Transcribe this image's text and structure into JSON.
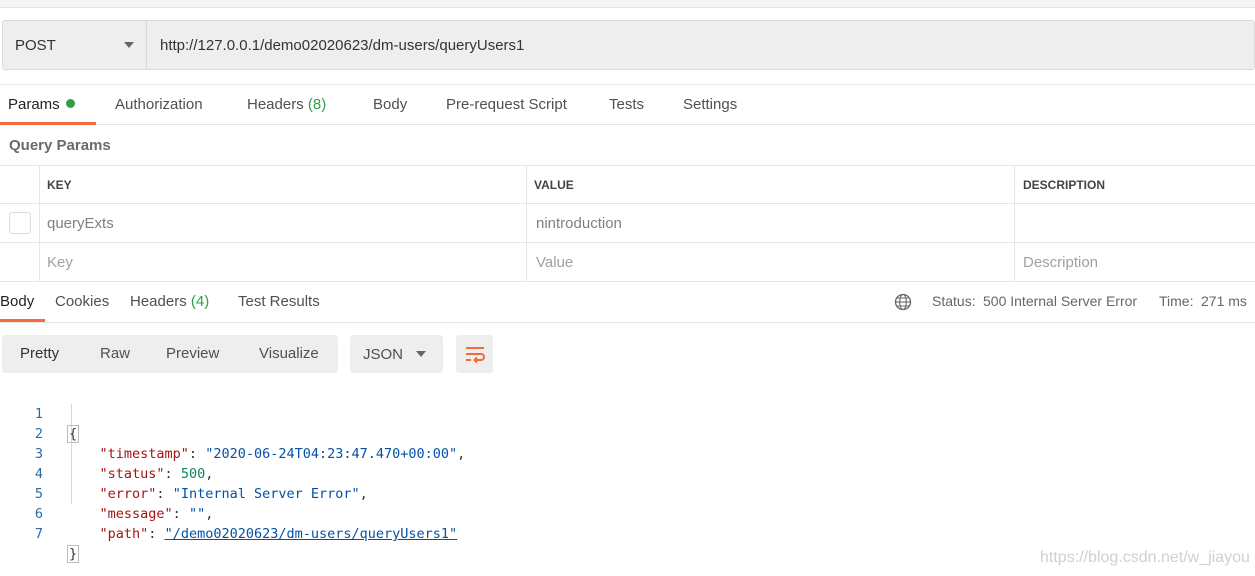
{
  "request": {
    "method": "POST",
    "url": "http://127.0.0.1/demo02020623/dm-users/queryUsers1"
  },
  "request_tabs": {
    "params": "Params",
    "authorization": "Authorization",
    "headers": "Headers",
    "headers_count": "(8)",
    "body": "Body",
    "prerequest": "Pre-request Script",
    "tests": "Tests",
    "settings": "Settings"
  },
  "query_params": {
    "title": "Query Params",
    "headers": {
      "key": "KEY",
      "value": "VALUE",
      "description": "DESCRIPTION"
    },
    "rows": [
      {
        "key": "queryExts",
        "value": "nintroduction",
        "description": ""
      }
    ],
    "placeholders": {
      "key": "Key",
      "value": "Value",
      "description": "Description"
    }
  },
  "response_tabs": {
    "body": "Body",
    "cookies": "Cookies",
    "headers": "Headers",
    "headers_count": "(4)",
    "test_results": "Test Results"
  },
  "response_status": {
    "status_label": "Status:",
    "status_value": "500 Internal Server Error",
    "time_label": "Time:",
    "time_value": "271 ms"
  },
  "view_modes": {
    "pretty": "Pretty",
    "raw": "Raw",
    "preview": "Preview",
    "visualize": "Visualize",
    "format": "JSON"
  },
  "response_body": {
    "line_numbers": [
      "1",
      "2",
      "3",
      "4",
      "5",
      "6",
      "7"
    ],
    "open_brace": "{",
    "close_brace": "}",
    "fields": [
      {
        "key": "\"timestamp\"",
        "value": "\"2020-06-24T04:23:47.470+00:00\"",
        "type": "string",
        "trailing": ","
      },
      {
        "key": "\"status\"",
        "value": "500",
        "type": "number",
        "trailing": ","
      },
      {
        "key": "\"error\"",
        "value": "\"Internal Server Error\"",
        "type": "string",
        "trailing": ","
      },
      {
        "key": "\"message\"",
        "value": "\"\"",
        "type": "string",
        "trailing": ","
      },
      {
        "key": "\"path\"",
        "value": "\"/demo02020623/dm-users/queryUsers1\"",
        "type": "link",
        "trailing": ""
      }
    ]
  },
  "watermark": "https://blog.csdn.net/w_jiayou",
  "colors": {
    "accent_orange": "#f26b3a",
    "success_green": "#2ea043",
    "json_key": "#a31515",
    "json_string": "#0451a5",
    "json_number": "#098658"
  },
  "icons": {
    "method_dropdown": "chevron-down-icon",
    "params_indicator": "green-dot-icon",
    "globe": "globe-icon",
    "format_dropdown": "chevron-down-icon",
    "wrap": "wrap-lines-icon"
  }
}
